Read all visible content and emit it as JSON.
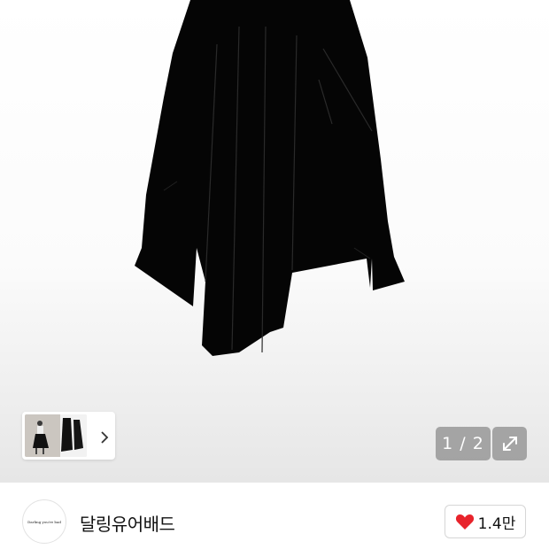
{
  "gallery": {
    "image_alt": "black asymmetric pleated skirt",
    "current": 1,
    "total": 2,
    "counter_text": "1 / 2",
    "more_icon": "chevron-right-icon",
    "expand_icon": "expand-icon"
  },
  "brand": {
    "logo_text": "Darling you're bad",
    "name": "달링유어배드"
  },
  "like": {
    "icon": "heart-icon",
    "count": "1.4만",
    "color": "#e8232b"
  }
}
